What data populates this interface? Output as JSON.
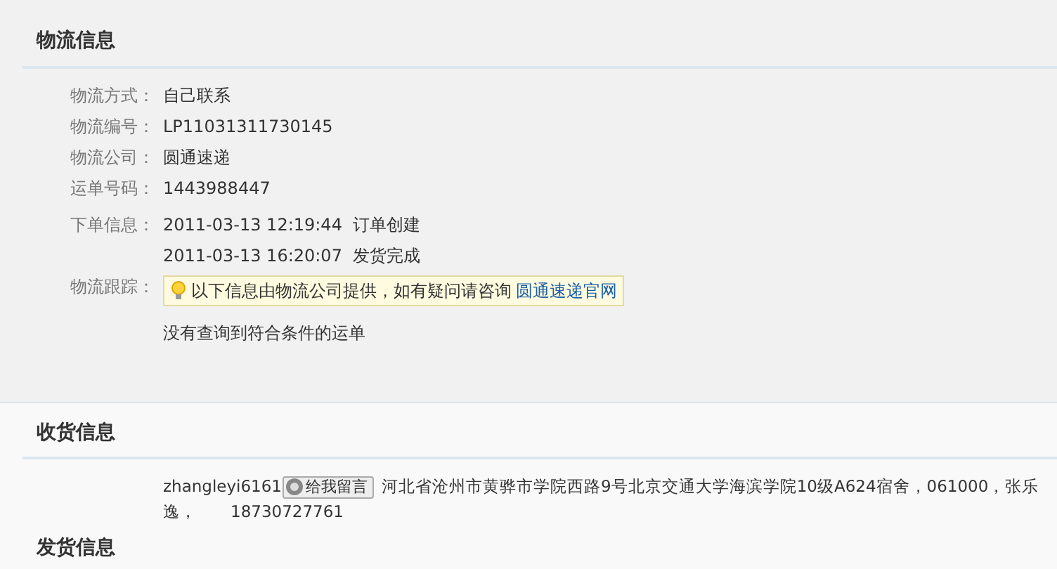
{
  "logistics": {
    "title": "物流信息",
    "fields": [
      {
        "label": "物流方式：",
        "value": "自己联系"
      },
      {
        "label": "物流编号：",
        "value": "LP11031311730145"
      },
      {
        "label": "物流公司：",
        "value": "圆通速递"
      },
      {
        "label": "运单号码：",
        "value": "1443988447"
      }
    ],
    "order_info": {
      "label": "下单信息：",
      "events": [
        {
          "time": "2011-03-13 12:19:44",
          "event": "订单创建"
        },
        {
          "time": "2011-03-13 16:20:07",
          "event": "发货完成"
        }
      ]
    },
    "tracking": {
      "label": "物流跟踪：",
      "notice": "以下信息由物流公司提供，如有疑问请咨询",
      "notice_link": "圆通速递官网",
      "result": "没有查询到符合条件的运单"
    }
  },
  "receiver": {
    "title": "收货信息",
    "buyer": "zhangleyi6161",
    "message_button": "给我留言",
    "address_lines": [
      "河北省沧州市黄骅市学院西路9号北京交通大学海滨学院10级A624宿舍，061000，张乐",
      "逸，"
    ],
    "phone": "18730727761"
  },
  "sender": {
    "title": "发货信息"
  }
}
